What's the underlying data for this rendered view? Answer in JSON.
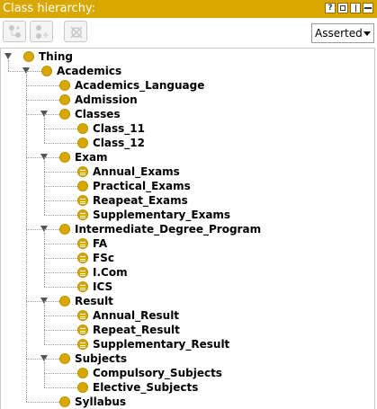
{
  "panel": {
    "title": "Class hierarchy:",
    "window_buttons": [
      "?",
      "restore",
      "split",
      "close"
    ]
  },
  "toolbar": {
    "add_subclass_icon": "add-subclass-icon",
    "add_sibling_icon": "add-sibling-icon",
    "delete_icon": "delete-class-icon",
    "view_mode": "Asserted"
  },
  "colors": {
    "accent": "#d8a800",
    "icon": "#d8a800"
  },
  "tree": [
    {
      "label": "Thing",
      "level": 0,
      "expanded": true,
      "icon": "class"
    },
    {
      "label": "Academics",
      "level": 1,
      "expanded": true,
      "icon": "class"
    },
    {
      "label": "Academics_Language",
      "level": 2,
      "icon": "class"
    },
    {
      "label": "Admission",
      "level": 2,
      "icon": "class"
    },
    {
      "label": "Classes",
      "level": 2,
      "expanded": true,
      "icon": "class"
    },
    {
      "label": "Class_11",
      "level": 3,
      "icon": "class"
    },
    {
      "label": "Class_12",
      "level": 3,
      "icon": "class"
    },
    {
      "label": "Exam",
      "level": 2,
      "expanded": true,
      "icon": "class"
    },
    {
      "label": "Annual_Exams",
      "level": 3,
      "icon": "defined"
    },
    {
      "label": "Practical_Exams",
      "level": 3,
      "icon": "class"
    },
    {
      "label": "Reapeat_Exams",
      "level": 3,
      "icon": "defined"
    },
    {
      "label": "Supplementary_Exams",
      "level": 3,
      "icon": "defined"
    },
    {
      "label": "Intermediate_Degree_Program",
      "level": 2,
      "expanded": true,
      "icon": "class"
    },
    {
      "label": "FA",
      "level": 3,
      "icon": "defined"
    },
    {
      "label": "FSc",
      "level": 3,
      "icon": "defined"
    },
    {
      "label": "I.Com",
      "level": 3,
      "icon": "defined"
    },
    {
      "label": "ICS",
      "level": 3,
      "icon": "defined"
    },
    {
      "label": "Result",
      "level": 2,
      "expanded": true,
      "icon": "class"
    },
    {
      "label": "Annual_Result",
      "level": 3,
      "icon": "defined"
    },
    {
      "label": "Repeat_Result",
      "level": 3,
      "icon": "defined"
    },
    {
      "label": "Supplementary_Result",
      "level": 3,
      "icon": "defined"
    },
    {
      "label": "Subjects",
      "level": 2,
      "expanded": true,
      "icon": "class"
    },
    {
      "label": "Compulsory_Subjects",
      "level": 3,
      "icon": "class"
    },
    {
      "label": "Elective_Subjects",
      "level": 3,
      "icon": "class"
    },
    {
      "label": "Syllabus",
      "level": 2,
      "icon": "class"
    }
  ]
}
